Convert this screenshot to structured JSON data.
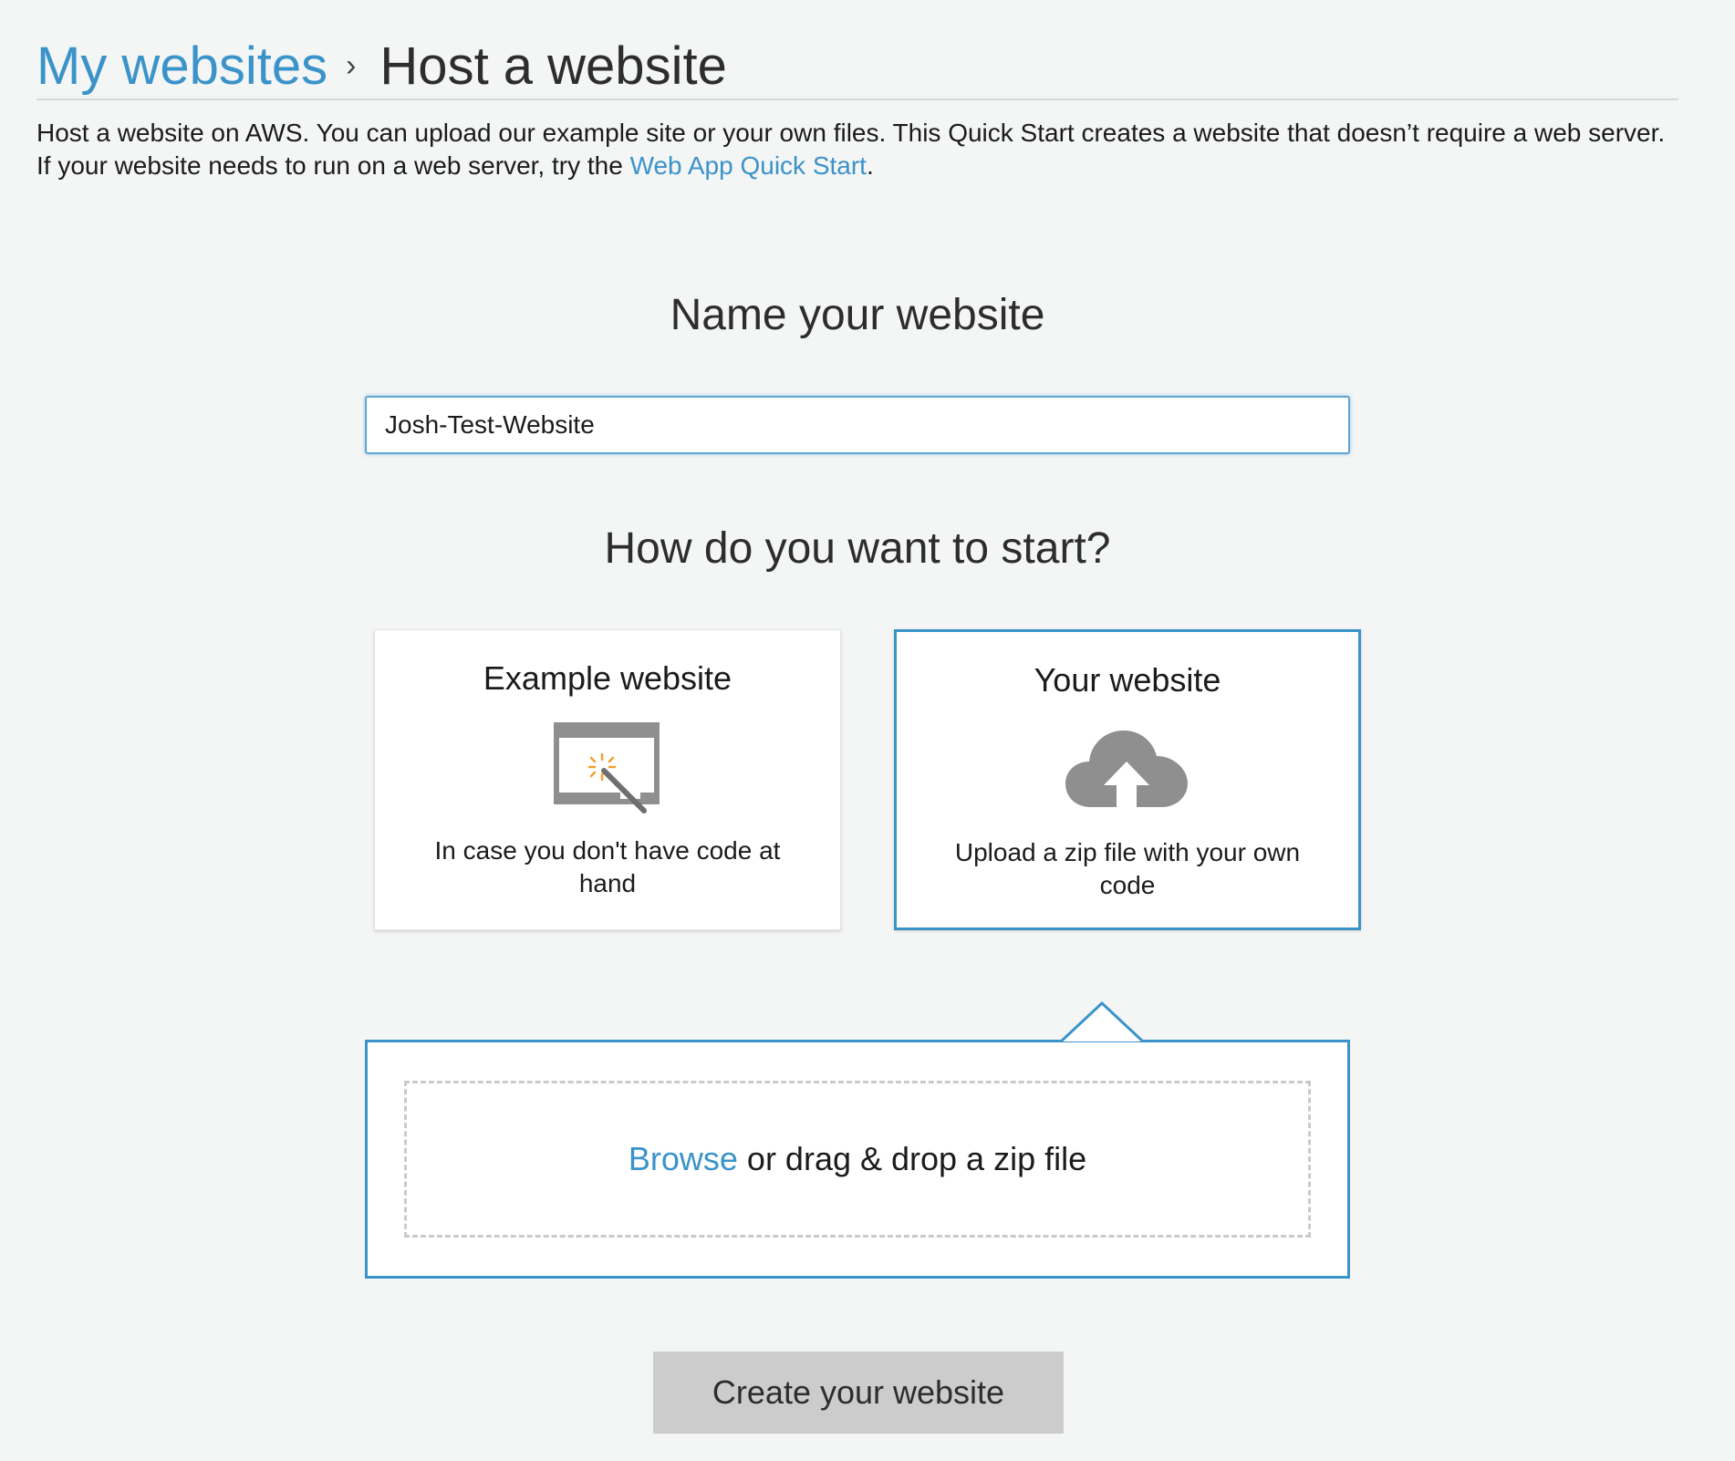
{
  "breadcrumb": {
    "root": "My websites",
    "separator": "›",
    "current": "Host a website"
  },
  "intro": {
    "text": "Host a website on AWS. You can upload our example site or your own files. This Quick Start creates a website that doesn’t require a web server. If your website needs to run on a web server, try the ",
    "link": "Web App Quick Start",
    "suffix": "."
  },
  "name_section": {
    "title": "Name your website",
    "input_value": "Josh-Test-Website"
  },
  "start_section": {
    "title": "How do you want to start?",
    "options": [
      {
        "title": "Example website",
        "description": "In case you don't have code at hand",
        "icon": "browser-magic-wand-icon",
        "selected": false
      },
      {
        "title": "Your website",
        "description": "Upload a zip file with your own code",
        "icon": "cloud-upload-icon",
        "selected": true
      }
    ]
  },
  "upload": {
    "browse_label": "Browse",
    "drop_text": "or drag & drop a zip file"
  },
  "actions": {
    "create_label": "Create your website"
  },
  "colors": {
    "accent": "#3a93c9",
    "background": "#f4f5f5",
    "icon_gray": "#8f8f8f",
    "spark_orange": "#f0a030",
    "button_disabled": "#cccccc"
  }
}
